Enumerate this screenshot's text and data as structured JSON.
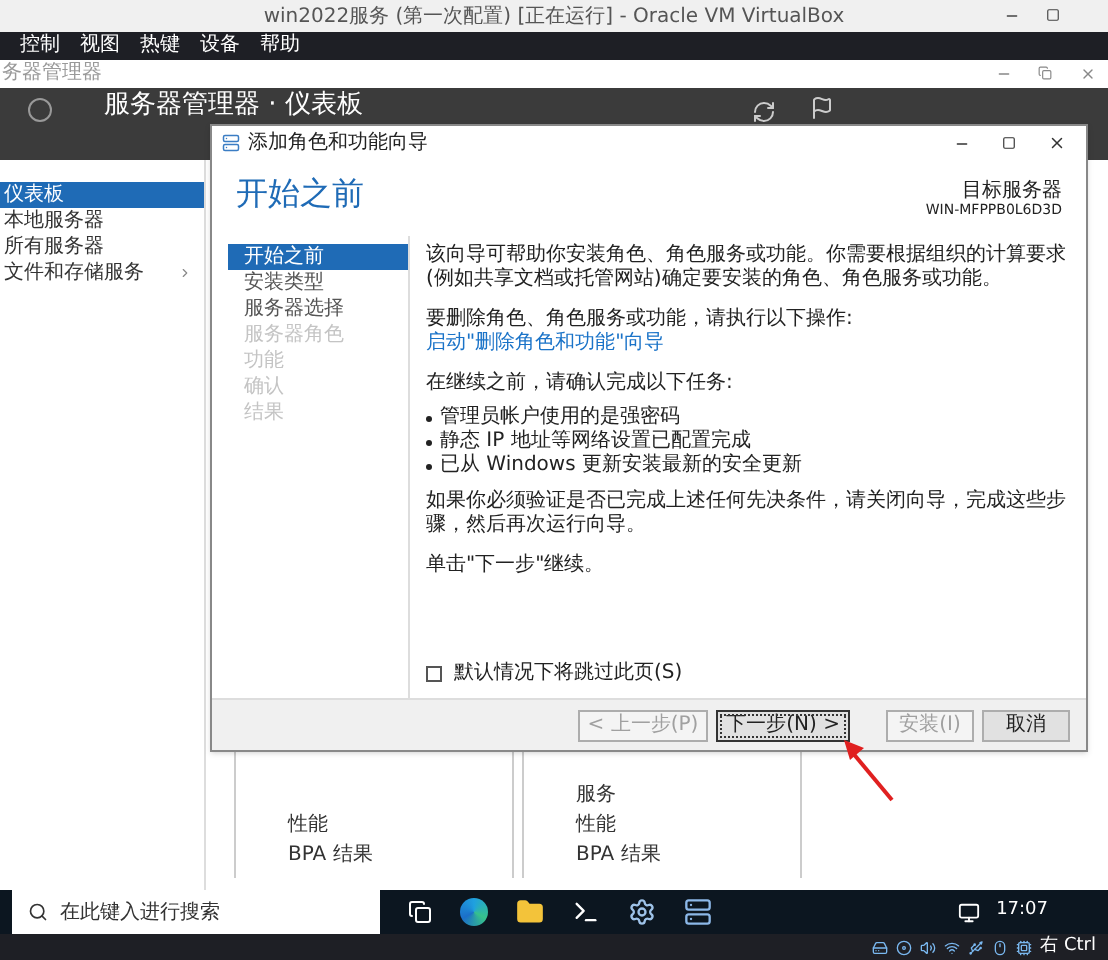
{
  "host_window": {
    "title": "win2022服务 (第一次配置) [正在运行] - Oracle VM VirtualBox"
  },
  "host_menu": [
    "控制",
    "视图",
    "热键",
    "设备",
    "帮助"
  ],
  "server_manager": {
    "title": "务器管理器",
    "breadcrumb": "服务器管理器 · 仪表板",
    "nav": [
      {
        "label": "仪表板",
        "selected": true,
        "expandable": false
      },
      {
        "label": "本地服务器",
        "selected": false,
        "expandable": false
      },
      {
        "label": "所有服务器",
        "selected": false,
        "expandable": false
      },
      {
        "label": "文件和存储服务",
        "selected": false,
        "expandable": true
      }
    ],
    "tiles": [
      {
        "items": [
          "性能",
          "BPA 结果"
        ]
      },
      {
        "items": [
          "服务",
          "性能",
          "BPA 结果"
        ]
      }
    ]
  },
  "wizard": {
    "title": "添加角色和功能向导",
    "heading": "开始之前",
    "target_label": "目标服务器",
    "target_name": "WIN-MFPPB0L6D3D",
    "steps": [
      {
        "label": "开始之前",
        "selected": true,
        "disabled": false
      },
      {
        "label": "安装类型",
        "selected": false,
        "disabled": false
      },
      {
        "label": "服务器选择",
        "selected": false,
        "disabled": false
      },
      {
        "label": "服务器角色",
        "selected": false,
        "disabled": true
      },
      {
        "label": "功能",
        "selected": false,
        "disabled": true
      },
      {
        "label": "确认",
        "selected": false,
        "disabled": true
      },
      {
        "label": "结果",
        "selected": false,
        "disabled": true
      }
    ],
    "intro": "该向导可帮助你安装角色、角色服务或功能。你需要根据组织的计算要求(例如共享文档或托管网站)确定要安装的角色、角色服务或功能。",
    "remove_text": "要删除角色、角色服务或功能，请执行以下操作:",
    "remove_link": "启动\"删除角色和功能\"向导",
    "prereq_intro": "在继续之前，请确认完成以下任务:",
    "prereqs": [
      "管理员帐户使用的是强密码",
      "静态 IP 地址等网络设置已配置完成",
      "已从 Windows 更新安装最新的安全更新"
    ],
    "verify_text": "如果你必须验证是否已完成上述任何先决条件，请关闭向导，完成这些步骤，然后再次运行向导。",
    "continue_text": "单击\"下一步\"继续。",
    "skip_checkbox": {
      "label": "默认情况下将跳过此页(S)",
      "checked": false
    },
    "buttons": [
      {
        "label": "< 上一步(P)",
        "disabled": true,
        "focused": false
      },
      {
        "label": "下一步(N) >",
        "disabled": false,
        "focused": true
      },
      {
        "label": "安装(I)",
        "disabled": true,
        "focused": false
      },
      {
        "label": "取消",
        "disabled": false,
        "focused": false
      }
    ]
  },
  "taskbar": {
    "search_placeholder": "在此键入进行搜索",
    "time": "17:07"
  },
  "host_status": {
    "host_key": "右 Ctrl"
  }
}
